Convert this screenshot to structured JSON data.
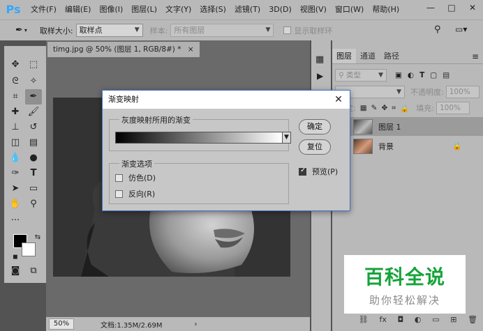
{
  "menubar": {
    "logo": "Ps",
    "items": [
      "文件(F)",
      "编辑(E)",
      "图像(I)",
      "图层(L)",
      "文字(Y)",
      "选择(S)",
      "滤镜(T)",
      "3D(D)",
      "视图(V)",
      "窗口(W)",
      "帮助(H)"
    ],
    "window_controls": [
      "—",
      "□",
      "✕"
    ]
  },
  "options": {
    "sample_size_label": "取样大小:",
    "sample_size_value": "取样点",
    "sample_label": "样本:",
    "sample_value": "所有图层",
    "show_ring_label": "显示取样环"
  },
  "document": {
    "tab_title": "timg.jpg @ 50% (图层 1, RGB/8#) *",
    "tab_close": "×",
    "zoom": "50%",
    "doc_info": "文档:1.35M/2.69M",
    "status_arrow": "›"
  },
  "dialog": {
    "title": "渐变映射",
    "close_glyph": "✕",
    "gradient_group_label": "灰度映射所用的渐变",
    "options_group_label": "渐变选项",
    "dither_label": "仿色(D)",
    "reverse_label": "反向(R)",
    "ok_label": "确定",
    "reset_label": "复位",
    "preview_label": "预览(P)",
    "preview_checked": true,
    "dither_checked": false,
    "reverse_checked": false,
    "gradient_from": "#000000",
    "gradient_to": "#ffffff"
  },
  "layers_panel": {
    "tabs": [
      "图层",
      "通道",
      "路径"
    ],
    "active_tab": "图层",
    "filter_kind": "类型",
    "opacity_label": "不透明度:",
    "opacity_value": "100%",
    "lock_label": "锁定:",
    "fill_label": "填充:",
    "fill_value": "100%",
    "layers": [
      {
        "name": "图层 1",
        "selected": true,
        "locked": false
      },
      {
        "name": "背景",
        "selected": false,
        "locked": true
      }
    ]
  },
  "watermark": {
    "title": "百科全说",
    "subtitle": "助你轻松解决"
  },
  "colors": {
    "foreground": "#000000",
    "background": "#ffffff",
    "watermark_green": "#15a33a",
    "ps_blue": "#31a8ff"
  }
}
